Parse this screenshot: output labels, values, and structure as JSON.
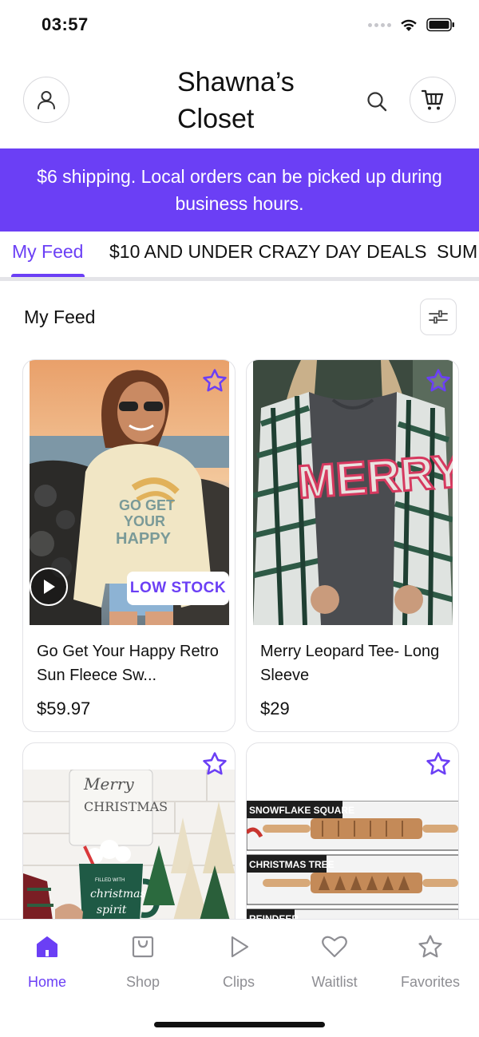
{
  "status_bar": {
    "time": "03:57"
  },
  "header": {
    "store_name": "Shawna’s Closet"
  },
  "banner": {
    "text": "$6 shipping. Local orders can be picked up during business hours."
  },
  "tabs": [
    {
      "label": "My Feed",
      "active": true
    },
    {
      "label": "$10 AND UNDER CRAZY DAY DEALS",
      "active": false
    },
    {
      "label": "SUMMER",
      "active": false
    }
  ],
  "feed": {
    "title": "My Feed"
  },
  "products": [
    {
      "name": "Go Get Your Happy Retro Sun Fleece Sw...",
      "price": "$59.97",
      "badge": "LOW STOCK",
      "image_text": "GO GET YOUR HAPPY",
      "has_video": true
    },
    {
      "name": "Merry Leopard Tee- Long Sleeve",
      "price": "$29",
      "badge": "",
      "image_text": "MERRY",
      "has_video": false
    },
    {
      "name": "",
      "price": "",
      "badge": "",
      "image_text": "Merry little Christmas",
      "mug_text": "FILLED WITH christmas spirit",
      "has_video": false
    },
    {
      "name": "",
      "price": "",
      "badge": "",
      "labels": [
        "SNOWFLAKE SQUARE",
        "CHRISTMAS TREE",
        "REINDEER"
      ],
      "has_video": false
    }
  ],
  "bottom_nav": [
    {
      "label": "Home",
      "icon": "home-icon",
      "active": true
    },
    {
      "label": "Shop",
      "icon": "shopping-bag-icon",
      "active": false
    },
    {
      "label": "Clips",
      "icon": "play-icon",
      "active": false
    },
    {
      "label": "Waitlist",
      "icon": "heart-icon",
      "active": false
    },
    {
      "label": "Favorites",
      "icon": "star-icon",
      "active": false
    }
  ],
  "colors": {
    "accent": "#6b3ff5",
    "inactive": "#8e8e93"
  }
}
